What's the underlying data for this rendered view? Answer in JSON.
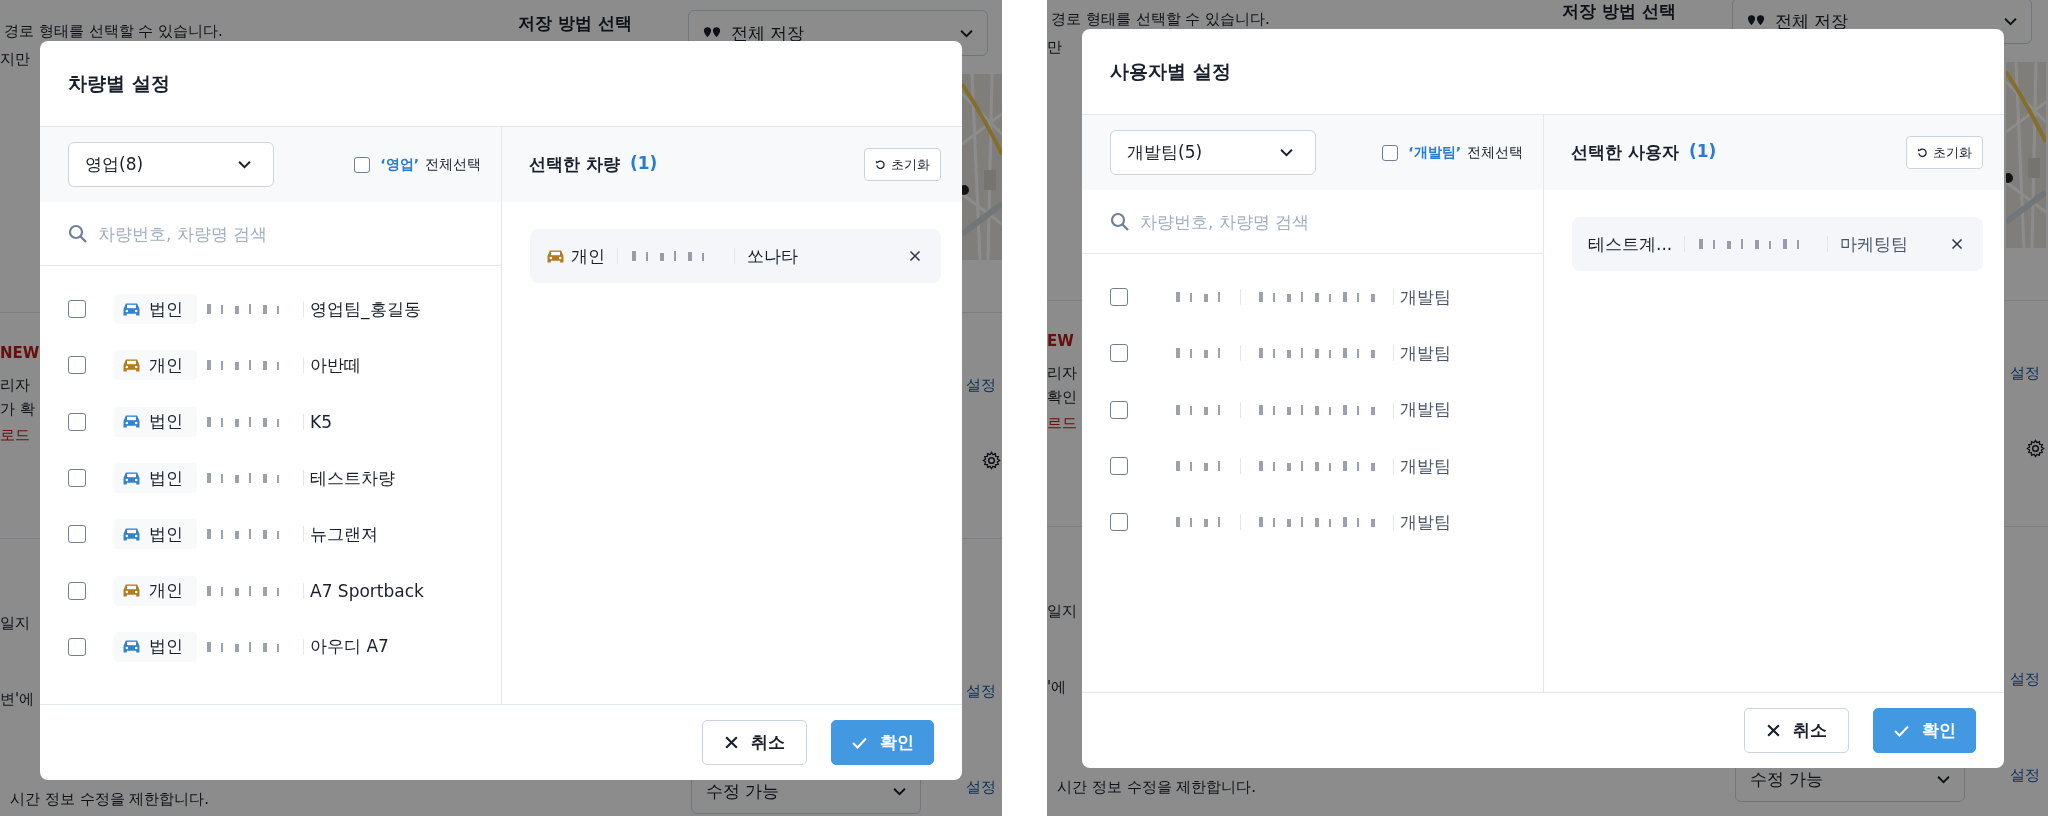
{
  "screens": [
    {
      "background": [
        {
          "kind": "text",
          "text": "경로 형태를 선택할 수 있습니다."
        },
        {
          "kind": "text",
          "text": "지만"
        },
        {
          "kind": "heading",
          "text": "저장 방법 선택"
        },
        {
          "kind": "select",
          "text": "전체 저장"
        },
        {
          "kind": "new",
          "text": "NEW"
        },
        {
          "kind": "text",
          "text": "리자"
        },
        {
          "kind": "text",
          "text": "가 확"
        },
        {
          "kind": "warning",
          "text": "로드"
        },
        {
          "kind": "link",
          "text": "설정"
        },
        {
          "kind": "text",
          "text": "일지"
        },
        {
          "kind": "text",
          "text": "변'에"
        },
        {
          "kind": "link",
          "text": "설정"
        },
        {
          "kind": "text",
          "text": "시간 정보 수정을 제한합니다."
        },
        {
          "kind": "select",
          "text": "수정 가능"
        },
        {
          "kind": "link",
          "text": "설정"
        }
      ],
      "modal": {
        "title": "차량별 설정",
        "group_select": "영업(8)",
        "select_all": {
          "group": "‘영업’",
          "label": "전체선택",
          "checked": false
        },
        "search_placeholder": "차량번호, 차량명 검색",
        "items": [
          {
            "kind": "vehicle",
            "type": "법인",
            "color": "#3182ce",
            "name": "영업팀_홍길동",
            "checked": false
          },
          {
            "kind": "vehicle",
            "type": "개인",
            "color": "#b7791f",
            "name": "아반떼",
            "checked": false
          },
          {
            "kind": "vehicle",
            "type": "법인",
            "color": "#3182ce",
            "name": "K5",
            "checked": false
          },
          {
            "kind": "vehicle",
            "type": "법인",
            "color": "#3182ce",
            "name": "테스트차량",
            "checked": false
          },
          {
            "kind": "vehicle",
            "type": "법인",
            "color": "#3182ce",
            "name": "뉴그랜져",
            "checked": false
          },
          {
            "kind": "vehicle",
            "type": "개인",
            "color": "#b7791f",
            "name": "A7 Sportback",
            "checked": false
          },
          {
            "kind": "vehicle",
            "type": "법인",
            "color": "#3182ce",
            "name": "아우디 A7",
            "checked": false
          }
        ],
        "selected_title": "선택한 차량",
        "selected_count": "(1)",
        "reset": "초기화",
        "selected": [
          {
            "kind": "vehicle",
            "type": "개인",
            "color": "#b7791f",
            "name": "쏘나타"
          }
        ],
        "cancel": "취소",
        "confirm": "확인"
      }
    },
    {
      "background": [
        {
          "kind": "text",
          "text": "경로 형태를 선택할 수 있습니다."
        },
        {
          "kind": "text",
          "text": "만"
        },
        {
          "kind": "heading",
          "text": "저장 방법 선택"
        },
        {
          "kind": "select",
          "text": "전체 저장"
        },
        {
          "kind": "new",
          "text": "EW"
        },
        {
          "kind": "text",
          "text": "리자"
        },
        {
          "kind": "text",
          "text": "확인"
        },
        {
          "kind": "warning",
          "text": "르드"
        },
        {
          "kind": "link",
          "text": "설정"
        },
        {
          "kind": "text",
          "text": "일지"
        },
        {
          "kind": "text",
          "text": "'에"
        },
        {
          "kind": "link",
          "text": "설정"
        },
        {
          "kind": "text",
          "text": "시간 정보 수정을 제한합니다."
        },
        {
          "kind": "select",
          "text": "수정 가능"
        },
        {
          "kind": "link",
          "text": "설정"
        }
      ],
      "modal": {
        "title": "사용자별 설정",
        "group_select": "개발팀(5)",
        "select_all": {
          "group": "‘개발팀’",
          "label": "전체선택",
          "checked": false
        },
        "search_placeholder": "차량번호, 차량명 검색",
        "items": [
          {
            "kind": "user",
            "team": "개발팀",
            "checked": false
          },
          {
            "kind": "user",
            "team": "개발팀",
            "checked": false
          },
          {
            "kind": "user",
            "team": "개발팀",
            "checked": false
          },
          {
            "kind": "user",
            "team": "개발팀",
            "checked": false
          },
          {
            "kind": "user",
            "team": "개발팀",
            "checked": false
          }
        ],
        "selected_title": "선택한 사용자",
        "selected_count": "(1)",
        "reset": "초기화",
        "selected": [
          {
            "kind": "user",
            "name": "테스트계...",
            "team": "마케팅팀"
          }
        ],
        "cancel": "취소",
        "confirm": "확인"
      }
    }
  ]
}
